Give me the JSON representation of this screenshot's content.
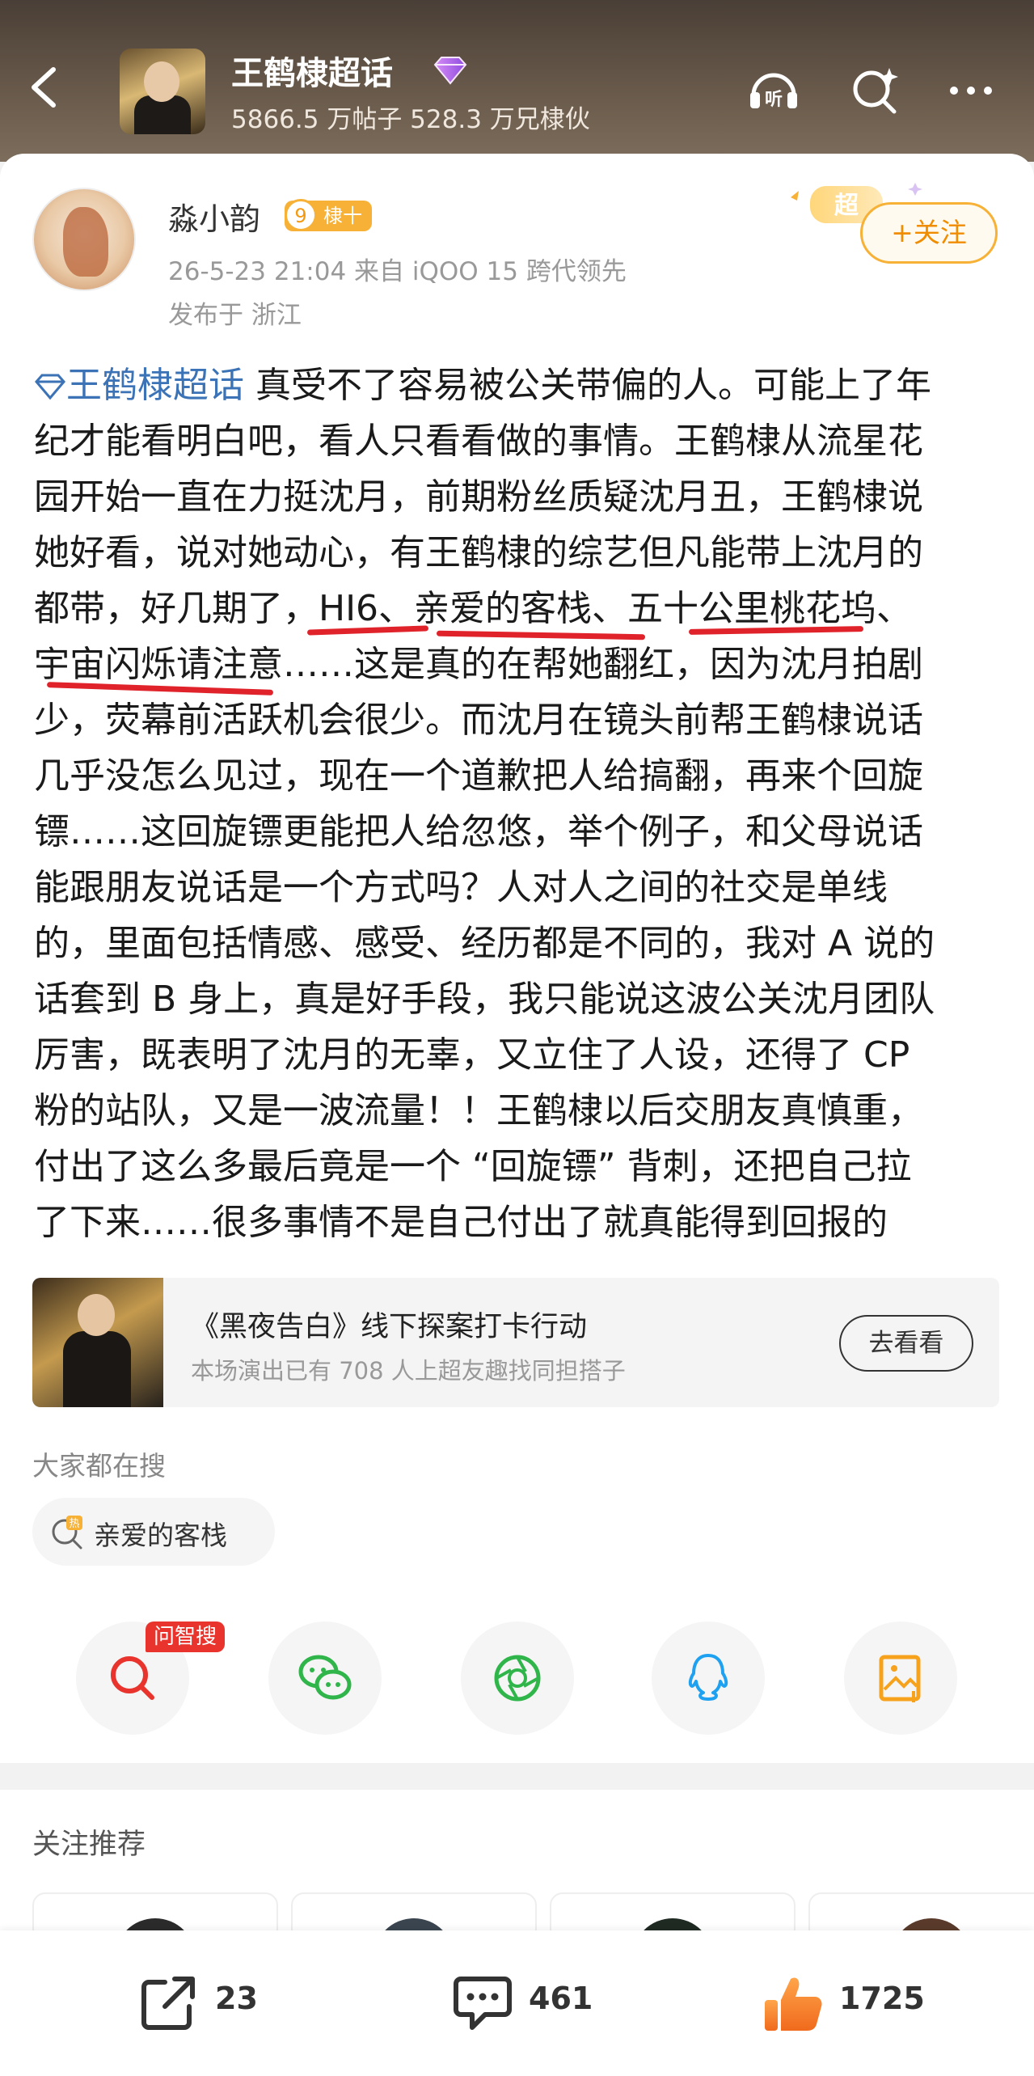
{
  "header": {
    "title": "王鹤棣超话",
    "stats": "5866.5 万帖子  528.3 万兄棣伙",
    "listen_label": "听"
  },
  "post": {
    "author": "淼小韵",
    "level": "9",
    "badge": "棣十",
    "meta": "26-5-23 21:04  来自 iQOO 15 跨代领先",
    "location": "发布于 浙江",
    "super_tag": "超",
    "follow_label": "+关注",
    "topic": "王鹤棣超话",
    "lines": [
      "真受不了容易被公关带偏的人。可能上了年",
      "纪才能看明白吧，看人只看看做的事情。王鹤棣从流星花",
      "园开始一直在力挺沈月，前期粉丝质疑沈月丑，王鹤棣说",
      "她好看，说对她动心，有王鹤棣的综艺但凡能带上沈月的",
      "都带，好几期了，HI6、亲爱的客栈、五十公里桃花坞、",
      "宇宙闪烁请注意……这是真的在帮她翻红，因为沈月拍剧",
      "少，荧幕前活跃机会很少。而沈月在镜头前帮王鹤棣说话",
      "几乎没怎么见过，现在一个道歉把人给搞翻，再来个回旋",
      "镖……这回旋镖更能把人给忽悠，举个例子，和父母说话",
      "能跟朋友说话是一个方式吗？人对人之间的社交是单线",
      "的，里面包括情感、感受、经历都是不同的，我对 A 说的",
      "话套到 B 身上，真是好手段，我只能说这波公关沈月团队",
      "厉害，既表明了沈月的无辜，又立住了人设，还得了 CP",
      "粉的站队，又是一波流量！！王鹤棣以后交朋友真慎重，",
      "付出了这么多最后竟是一个 “回旋镖” 背刺，还把自己拉",
      "了下来……很多事情不是自己付出了就真能得到回报的"
    ]
  },
  "promo": {
    "title": "《黑夜告白》线下探案打卡行动",
    "subtitle": "本场演出已有 708 人上超友趣找同担搭子",
    "button": "去看看"
  },
  "hot_search": {
    "label": "大家都在搜",
    "item": "亲爱的客栈",
    "hot_mark": "热"
  },
  "share": {
    "ask_badge": "问智搜",
    "icons": [
      "ask-search",
      "wechat",
      "moments",
      "qq",
      "save-image"
    ]
  },
  "recommend": {
    "label": "关注推荐"
  },
  "actions": {
    "repost_count": "23",
    "comment_count": "461",
    "like_count": "1725"
  },
  "colors": {
    "accent_orange": "#f6b136",
    "topic_blue": "#3b73b6",
    "underline_red": "#e0232b",
    "like_orange": "#f07a2a"
  }
}
